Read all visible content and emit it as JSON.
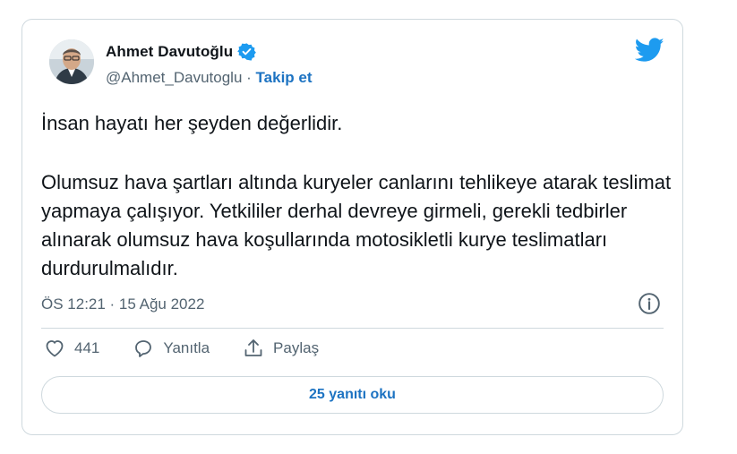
{
  "tweet": {
    "author_name": "Ahmet Davutoğlu",
    "handle": "@Ahmet_Davutoglu",
    "separator": "·",
    "follow_label": "Takip et",
    "paragraph1": "İnsan hayatı her şeyden değerlidir.",
    "paragraph2": "Olumsuz hava şartları altında kuryeler canlarını tehlikeye atarak teslimat yapmaya çalışıyor. Yetkililer derhal devreye girmeli, gerekli tedbirler alınarak olumsuz hava koşullarında motosikletli kurye teslimatları durdurulmalıdır.",
    "timestamp": "ÖS 12:21 · 15 Ağu 2022",
    "like_count": "441",
    "reply_label": "Yanıtla",
    "share_label": "Paylaş",
    "read_replies_label": "25 yanıtı oku"
  },
  "icons": {
    "brand": "twitter-bird-icon",
    "verified": "verified-badge-icon",
    "info": "info-icon",
    "like": "heart-icon",
    "reply": "reply-icon",
    "share": "share-icon"
  },
  "colors": {
    "accent": "#1d73c2",
    "bird": "#1d9bf0",
    "muted": "#536471",
    "border": "#cfd9de"
  }
}
